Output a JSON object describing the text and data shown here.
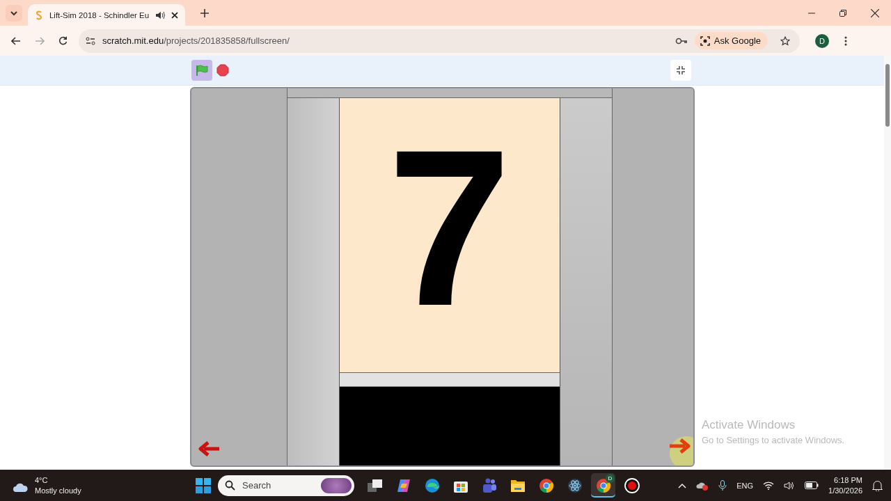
{
  "browser": {
    "tab": {
      "title": "Lift-Sim 2018 - Schindler Eu",
      "audio": true
    },
    "url_host": "scratch.mit.edu",
    "url_path": "/projects/201835858/fullscreen/",
    "ask_google": "Ask Google",
    "profile_initial": "D"
  },
  "scratch": {
    "running": true,
    "display_digit": "7"
  },
  "activation_notice": {
    "title": "Activate Windows",
    "subtitle": "Go to Settings to activate Windows."
  },
  "taskbar": {
    "weather_temp": "4°C",
    "weather_text": "Mostly cloudy",
    "search_placeholder": "Search",
    "apps": [
      {
        "kind": "task-view",
        "selected": false
      },
      {
        "kind": "copilot",
        "selected": false
      },
      {
        "kind": "edge",
        "selected": false
      },
      {
        "kind": "store",
        "selected": false
      },
      {
        "kind": "teams",
        "selected": false
      },
      {
        "kind": "folder",
        "selected": false
      },
      {
        "kind": "chrome",
        "selected": false
      },
      {
        "kind": "atom",
        "selected": false
      },
      {
        "kind": "chrome",
        "selected": true,
        "badge": "D"
      },
      {
        "kind": "record",
        "selected": false
      }
    ],
    "language": "ENG",
    "time": "6:18 PM",
    "date": "1/30/2026"
  }
}
